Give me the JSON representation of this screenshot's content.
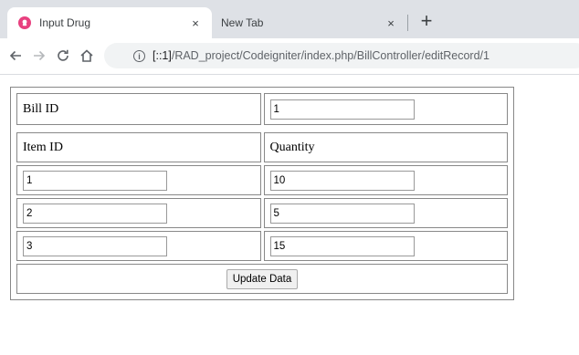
{
  "browser": {
    "tabs": [
      {
        "title": "Input Drug",
        "close": "×"
      },
      {
        "title": "New Tab",
        "close": "×"
      }
    ],
    "new_tab_label": "+",
    "url_host": "[::1]",
    "url_path": "/RAD_project/Codeigniter/index.php/BillController/editRecord/1"
  },
  "form": {
    "bill_id_label": "Bill ID",
    "bill_id_value": "1",
    "item_id_header": "Item ID",
    "quantity_header": "Quantity",
    "rows": [
      {
        "item_id": "1",
        "quantity": "10"
      },
      {
        "item_id": "2",
        "quantity": "5"
      },
      {
        "item_id": "3",
        "quantity": "15"
      }
    ],
    "submit_label": "Update Data"
  }
}
